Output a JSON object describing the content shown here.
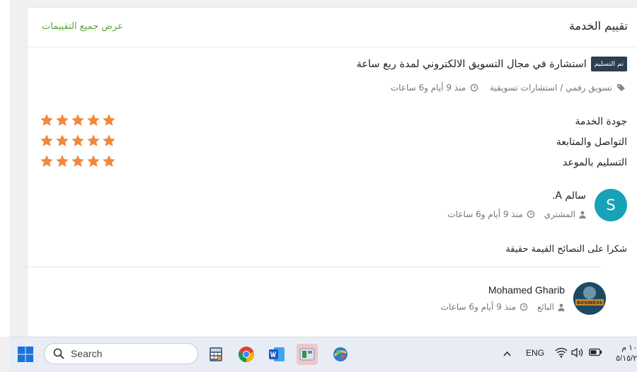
{
  "header": {
    "title": "تقييم الخدمة",
    "view_all": "عرض جميع التقييمات"
  },
  "service": {
    "badge": "تم التسليم",
    "title": "استشارة في مجال التسويق الالكتروني لمدة ربع ساعة",
    "category": "تسويق رقمي / استشارات تسويقية",
    "time": "منذ 9 أيام و6 ساعات"
  },
  "criteria": [
    {
      "label": "جودة الخدمة",
      "rating": 5,
      "max": 5
    },
    {
      "label": "التواصل والمتابعة",
      "rating": 5,
      "max": 5
    },
    {
      "label": "التسليم بالموعد",
      "rating": 5,
      "max": 5
    }
  ],
  "review": {
    "avatar_letter": "S",
    "avatar_color": "#17a2b8",
    "name": "سالم A.",
    "role": "المشتري",
    "time": "منذ 9 أيام و6 ساعات",
    "text": "شكرا على النصائح القيمة حقيقة"
  },
  "seller": {
    "name": "Mohamed Gharib",
    "avatar_text": "BUSINESS",
    "role": "البائع",
    "time": "منذ 9 أيام و6 ساعات"
  },
  "colors": {
    "accent_green": "#5aa63a",
    "star": "#f0883e",
    "badge_bg": "#2c3e50"
  },
  "taskbar": {
    "search_placeholder": "Search",
    "language": "ENG",
    "clock_time": "١٠ م",
    "clock_date": "٥/١٥/٢"
  }
}
